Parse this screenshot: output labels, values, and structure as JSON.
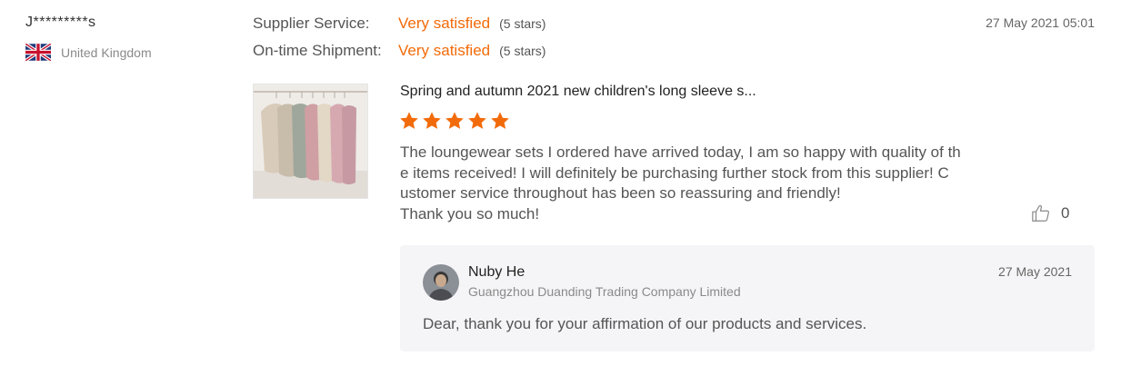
{
  "buyer": {
    "name": "J*********s",
    "country": "United Kingdom",
    "flag_icon": "uk-flag-icon"
  },
  "ratings": [
    {
      "label": "Supplier Service:",
      "value": "Very satisfied",
      "detail": "(5 stars)"
    },
    {
      "label": "On-time Shipment:",
      "value": "Very satisfied",
      "detail": "(5 stars)"
    }
  ],
  "review": {
    "date": "27 May 2021 05:01",
    "product_title": "Spring and autumn 2021 new children's long sleeve s...",
    "stars": 5,
    "text_lines": [
      "The loungewear sets I ordered have arrived today, I am so happy with quality of th",
      "e items received! I will definitely be purchasing further stock from this supplier! C",
      "ustomer service throughout has been so reassuring and friendly!",
      "Thank you so much!"
    ],
    "likes": "0"
  },
  "reply": {
    "name": "Nuby He",
    "company": "Guangzhou Duanding Trading Company Limited",
    "date": "27 May 2021",
    "text": "Dear, thank you for your affirmation of our products and services."
  },
  "colors": {
    "accent": "#f26b0a",
    "reply_bg": "#f5f5f7"
  }
}
